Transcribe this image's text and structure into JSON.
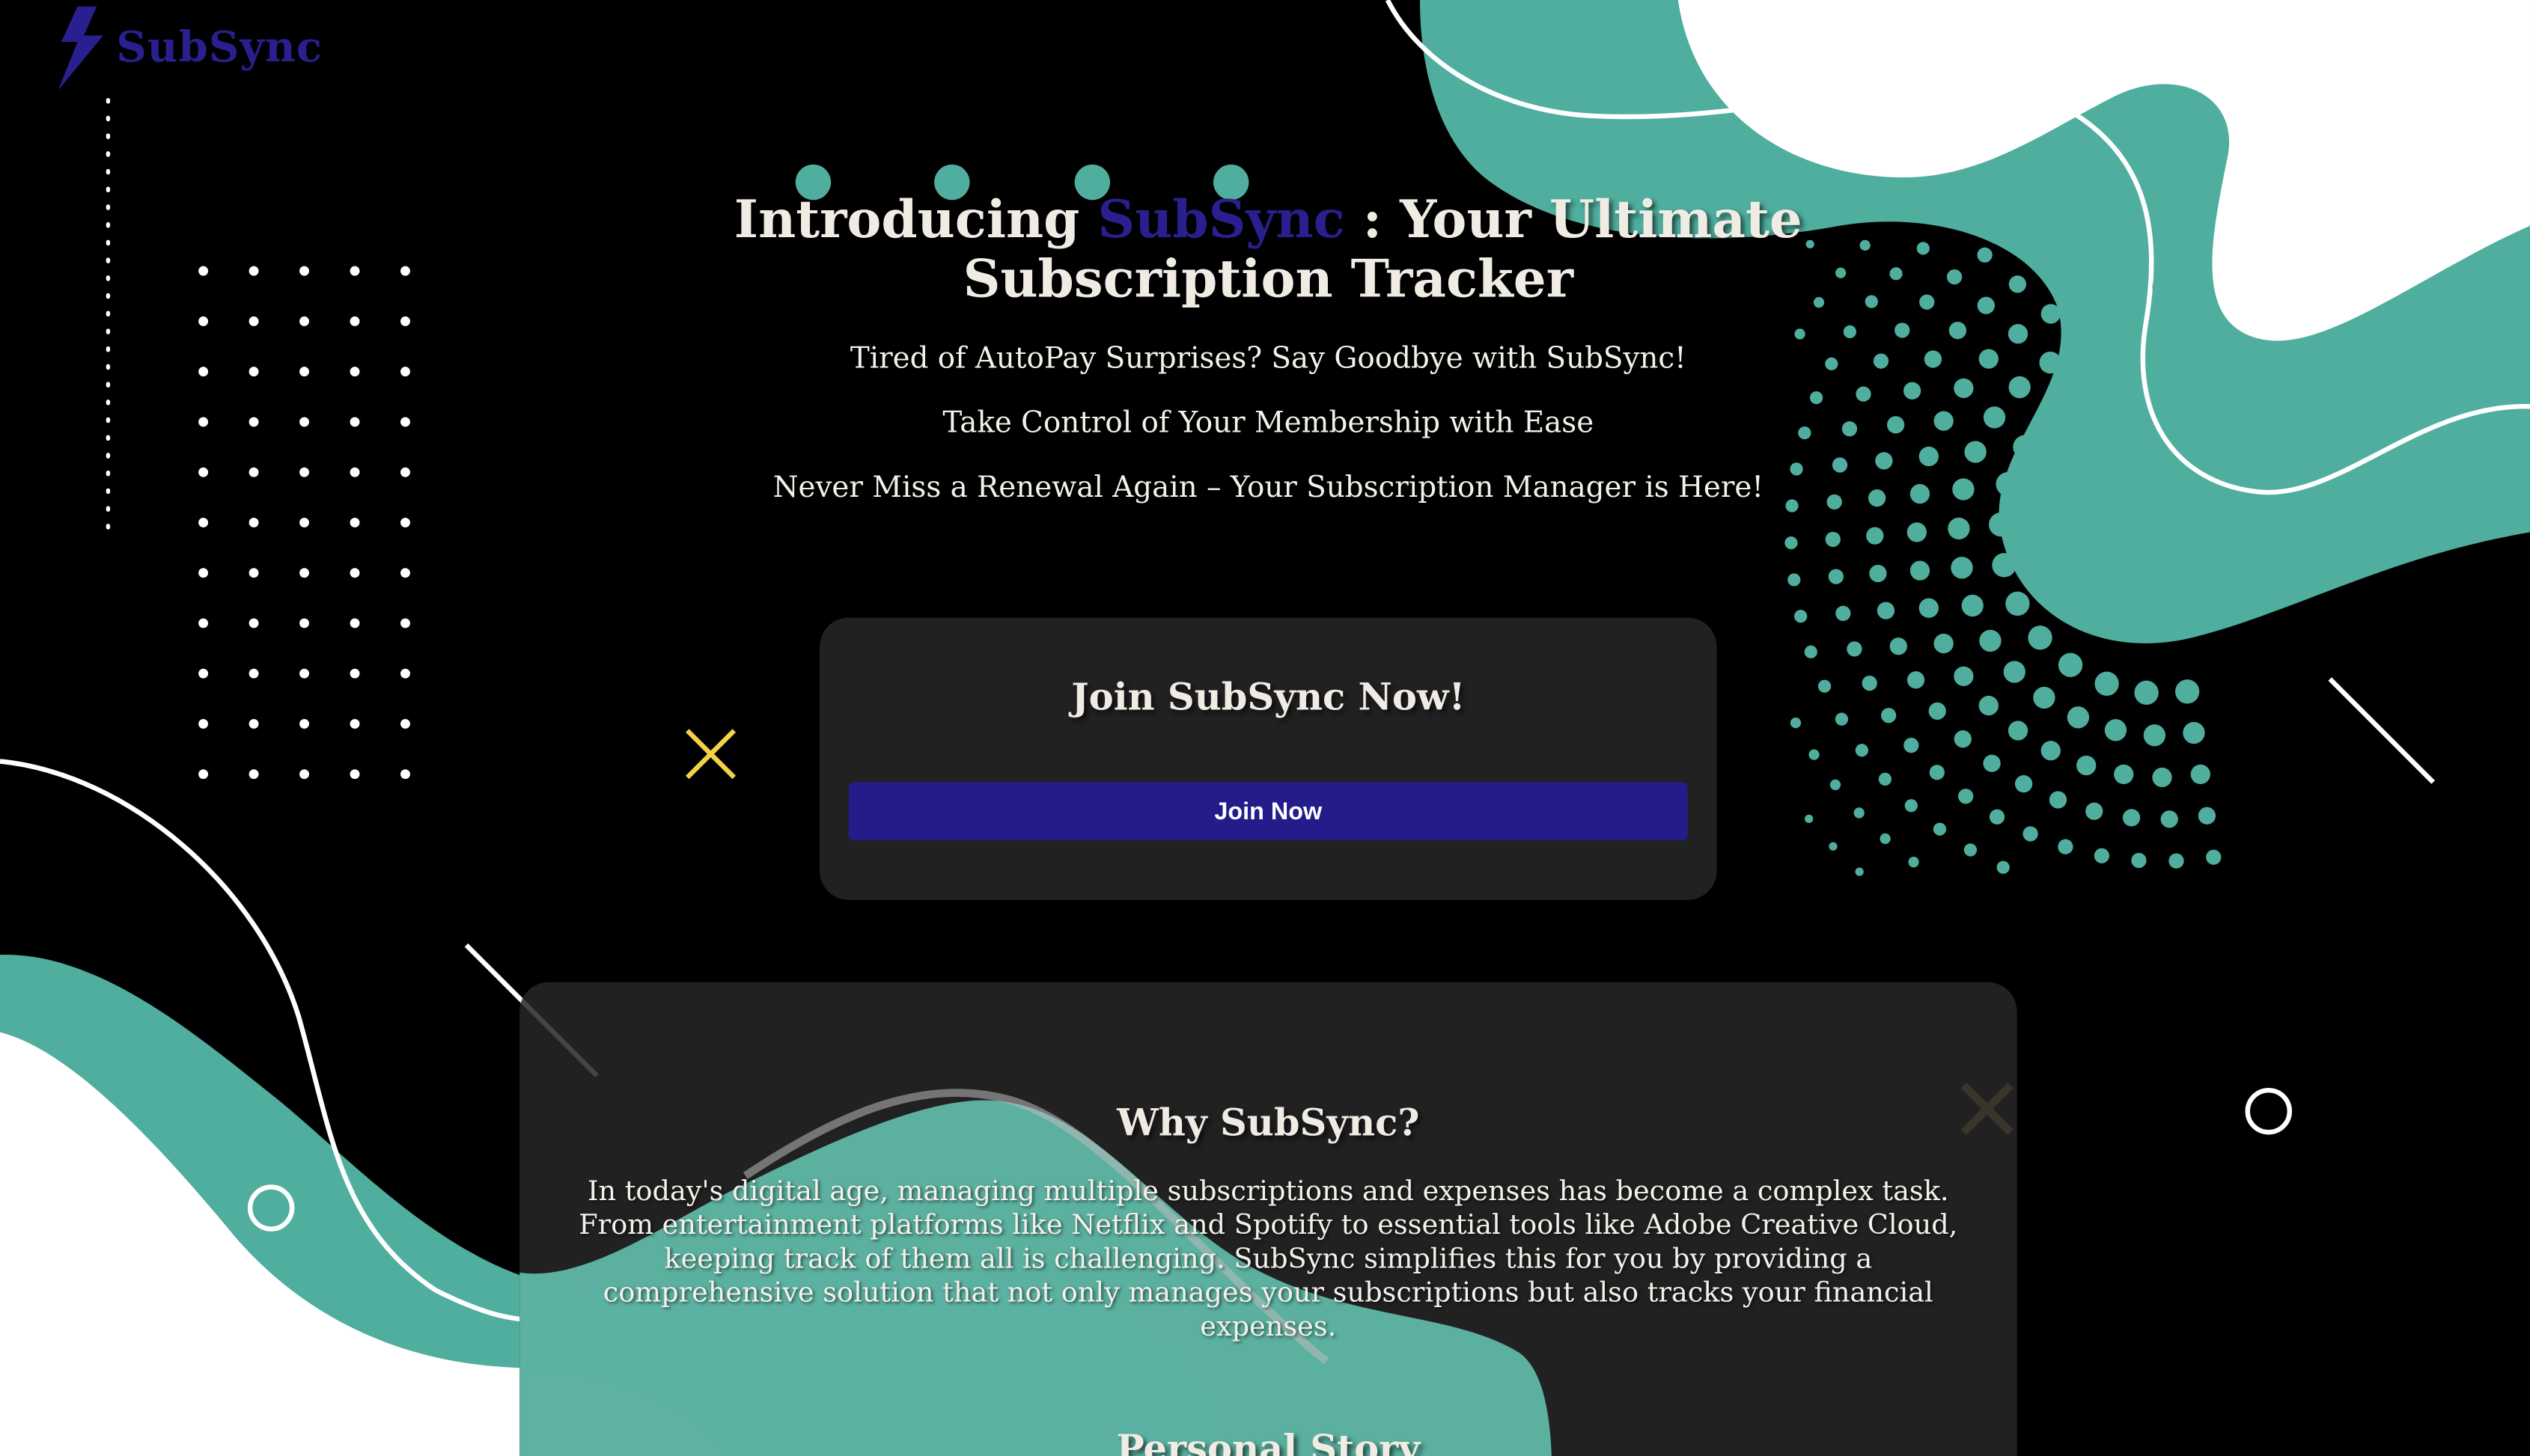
{
  "logo": {
    "text": "SubSync",
    "icon": "lightning-bolt-icon"
  },
  "hero": {
    "title_prefix": "Introducing ",
    "title_brand": "SubSync",
    "title_suffix": " : Your Ultimate Subscription Tracker",
    "taglines": [
      "Tired of AutoPay Surprises? Say Goodbye with SubSync!",
      "Take Control of Your Membership with Ease",
      "Never Miss a Renewal Again – Your Subscription Manager is Here!"
    ]
  },
  "join_card": {
    "title": "Join SubSync Now!",
    "button_label": "Join Now"
  },
  "why_card": {
    "title": "Why SubSync?",
    "body": "In today's digital age, managing multiple subscriptions and expenses has become a complex task. From entertainment platforms like Netflix and Spotify to essential tools like Adobe Creative Cloud, keeping track of them all is challenging. SubSync simplifies this for you by providing a comprehensive solution that not only manages your subscriptions but also tracks your financial expenses.",
    "next_title": "Personal Story"
  },
  "colors": {
    "background": "#000000",
    "teal": "#4fae9e",
    "brand": "#2a1f8f",
    "card": "#212121",
    "accent_yellow": "#f2d24a"
  }
}
